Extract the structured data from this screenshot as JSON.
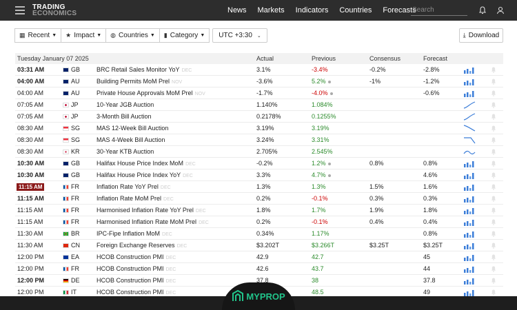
{
  "brand": {
    "line1": "TRADING",
    "line2": "ECONOMICS"
  },
  "nav": [
    "News",
    "Markets",
    "Indicators",
    "Countries",
    "Forecasts"
  ],
  "search": {
    "placeholder": "Search"
  },
  "filters": {
    "recent": "Recent",
    "impact": "Impact",
    "countries": "Countries",
    "category": "Category",
    "timezone": "UTC +3:30"
  },
  "download_label": "Download",
  "table": {
    "date_header": "Tuesday January 07 2025",
    "headers": {
      "actual": "Actual",
      "previous": "Previous",
      "consensus": "Consensus",
      "forecast": "Forecast"
    },
    "rows": [
      {
        "time": "03:31 AM",
        "bold": true,
        "cc": "GB",
        "flag": "gb",
        "event": "BRC Retail Sales Monitor YoY",
        "ref": "DEC",
        "actual": "3.1%",
        "previous": "-3.4%",
        "prev_color": "red",
        "consensus": "-0.2%",
        "forecast": "-2.8%",
        "spark": "bars"
      },
      {
        "time": "04:00 AM",
        "bold": true,
        "cc": "AU",
        "flag": "au",
        "event": "Building Permits MoM Prel",
        "ref": "NOV",
        "actual": "-3.6%",
        "previous": "5.2%",
        "prev_color": "green",
        "prev_dot": true,
        "consensus": "-1%",
        "forecast": "-1.2%",
        "spark": "bars"
      },
      {
        "time": "04:00 AM",
        "bold": false,
        "cc": "AU",
        "flag": "au",
        "event": "Private House Approvals MoM Prel",
        "ref": "NOV",
        "actual": "-1.7%",
        "previous": "-4.0%",
        "prev_color": "red",
        "prev_dot": true,
        "consensus": "",
        "forecast": "-0.6%",
        "spark": "bars"
      },
      {
        "time": "07:05 AM",
        "bold": false,
        "cc": "JP",
        "flag": "jp",
        "event": "10-Year JGB Auction",
        "ref": "",
        "actual": "1.140%",
        "previous": "1.084%",
        "prev_color": "green",
        "consensus": "",
        "forecast": "",
        "spark": "up"
      },
      {
        "time": "07:05 AM",
        "bold": false,
        "cc": "JP",
        "flag": "jp",
        "event": "3-Month Bill Auction",
        "ref": "",
        "actual": "0.2178%",
        "previous": "0.1255%",
        "prev_color": "green",
        "consensus": "",
        "forecast": "",
        "spark": "up"
      },
      {
        "time": "08:30 AM",
        "bold": false,
        "cc": "SG",
        "flag": "sg",
        "event": "MAS 12-Week Bill Auction",
        "ref": "",
        "actual": "3.19%",
        "previous": "3.19%",
        "prev_color": "green",
        "consensus": "",
        "forecast": "",
        "spark": "down"
      },
      {
        "time": "08:30 AM",
        "bold": false,
        "cc": "SG",
        "flag": "sg",
        "event": "MAS 4-Week Bill Auction",
        "ref": "",
        "actual": "3.24%",
        "previous": "3.31%",
        "prev_color": "green",
        "consensus": "",
        "forecast": "",
        "spark": "drop"
      },
      {
        "time": "08:30 AM",
        "bold": false,
        "cc": "KR",
        "flag": "kr",
        "event": "30-Year KTB Auction",
        "ref": "",
        "actual": "2.705%",
        "previous": "2.545%",
        "prev_color": "green",
        "consensus": "",
        "forecast": "",
        "spark": "wave"
      },
      {
        "time": "10:30 AM",
        "bold": true,
        "cc": "GB",
        "flag": "gb",
        "event": "Halifax House Price Index MoM",
        "ref": "DEC",
        "actual": "-0.2%",
        "previous": "1.2%",
        "prev_color": "green",
        "prev_dot": true,
        "consensus": "0.8%",
        "forecast": "0.8%",
        "spark": "bars"
      },
      {
        "time": "10:30 AM",
        "bold": true,
        "cc": "GB",
        "flag": "gb",
        "event": "Halifax House Price Index YoY",
        "ref": "DEC",
        "actual": "3.3%",
        "previous": "4.7%",
        "prev_color": "green",
        "prev_dot": true,
        "consensus": "",
        "forecast": "4.6%",
        "spark": "bars"
      },
      {
        "time": "11:15 AM",
        "highlight": true,
        "cc": "FR",
        "flag": "fr",
        "event": "Inflation Rate YoY Prel",
        "ref": "DEC",
        "actual": "1.3%",
        "previous": "1.3%",
        "prev_color": "green",
        "consensus": "1.5%",
        "forecast": "1.6%",
        "spark": "bars"
      },
      {
        "time": "11:15 AM",
        "bold": true,
        "cc": "FR",
        "flag": "fr",
        "event": "Inflation Rate MoM Prel",
        "ref": "DEC",
        "actual": "0.2%",
        "previous": "-0.1%",
        "prev_color": "red",
        "consensus": "0.3%",
        "forecast": "0.3%",
        "spark": "bars"
      },
      {
        "time": "11:15 AM",
        "bold": false,
        "cc": "FR",
        "flag": "fr",
        "event": "Harmonised Inflation Rate YoY Prel",
        "ref": "DEC",
        "actual": "1.8%",
        "previous": "1.7%",
        "prev_color": "green",
        "consensus": "1.9%",
        "forecast": "1.8%",
        "spark": "bars"
      },
      {
        "time": "11:15 AM",
        "bold": false,
        "cc": "FR",
        "flag": "fr",
        "event": "Harmonised Inflation Rate MoM Prel",
        "ref": "DEC",
        "actual": "0.2%",
        "previous": "-0.1%",
        "prev_color": "red",
        "consensus": "0.4%",
        "forecast": "0.4%",
        "spark": "bars"
      },
      {
        "time": "11:30 AM",
        "bold": false,
        "cc": "BR",
        "flag": "br",
        "event": "IPC-Fipe Inflation MoM",
        "ref": "DEC",
        "actual": "0.34%",
        "previous": "1.17%",
        "prev_color": "green",
        "consensus": "",
        "forecast": "0.8%",
        "spark": "bars"
      },
      {
        "time": "11:30 AM",
        "bold": false,
        "cc": "CN",
        "flag": "cn",
        "event": "Foreign Exchange Reserves",
        "ref": "DEC",
        "actual": "$3.202T",
        "previous": "$3.266T",
        "prev_color": "green",
        "consensus": "$3.25T",
        "forecast": "$3.25T",
        "spark": "bars"
      },
      {
        "time": "12:00 PM",
        "bold": false,
        "cc": "EA",
        "flag": "ea",
        "event": "HCOB Construction PMI",
        "ref": "DEC",
        "actual": "42.9",
        "previous": "42.7",
        "prev_color": "green",
        "consensus": "",
        "forecast": "45",
        "spark": "bars"
      },
      {
        "time": "12:00 PM",
        "bold": false,
        "cc": "FR",
        "flag": "fr",
        "event": "HCOB Construction PMI",
        "ref": "DEC",
        "actual": "42.6",
        "previous": "43.7",
        "prev_color": "green",
        "consensus": "",
        "forecast": "44",
        "spark": "bars"
      },
      {
        "time": "12:00 PM",
        "bold": true,
        "cc": "DE",
        "flag": "de",
        "event": "HCOB Construction PMI",
        "ref": "DEC",
        "actual": "37.8",
        "previous": "38",
        "prev_color": "green",
        "consensus": "",
        "forecast": "37.8",
        "spark": "bars"
      },
      {
        "time": "12:00 PM",
        "bold": false,
        "cc": "IT",
        "flag": "it",
        "event": "HCOB Construction PMI",
        "ref": "DEC",
        "actual": "",
        "previous": "48.5",
        "prev_color": "green",
        "consensus": "",
        "forecast": "49",
        "spark": "bars"
      }
    ]
  },
  "watermark": "MYPROP",
  "colors": {
    "navbar": "#2d2d2d",
    "spark": "#3b7dd8",
    "highlight": "#8b1a1a"
  }
}
